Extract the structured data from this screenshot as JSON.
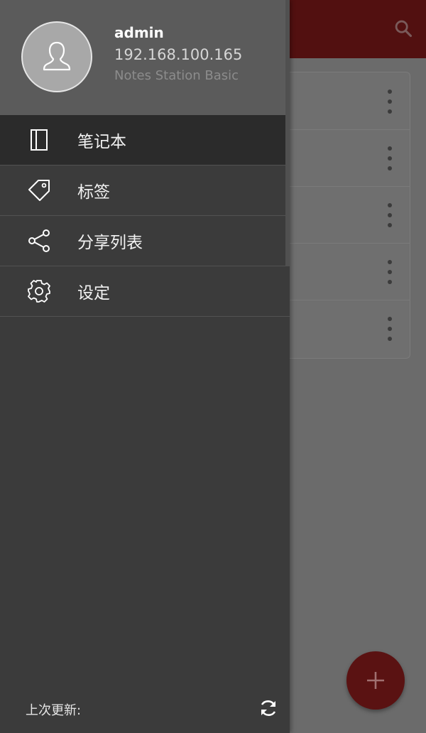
{
  "user": {
    "name": "admin",
    "server": "192.168.100.165",
    "app_name": "Notes Station Basic"
  },
  "menu": [
    {
      "label": "笔记本",
      "icon": "notebook-icon",
      "active": true
    },
    {
      "label": "标签",
      "icon": "tag-icon",
      "active": false
    },
    {
      "label": "分享列表",
      "icon": "share-icon",
      "active": false
    },
    {
      "label": "设定",
      "icon": "gear-icon",
      "active": false
    }
  ],
  "footer": {
    "last_update_label": "上次更新:"
  },
  "colors": {
    "brand": "#8b1a1a",
    "drawer": "#3b3b3b",
    "header": "#5b5b5b"
  }
}
